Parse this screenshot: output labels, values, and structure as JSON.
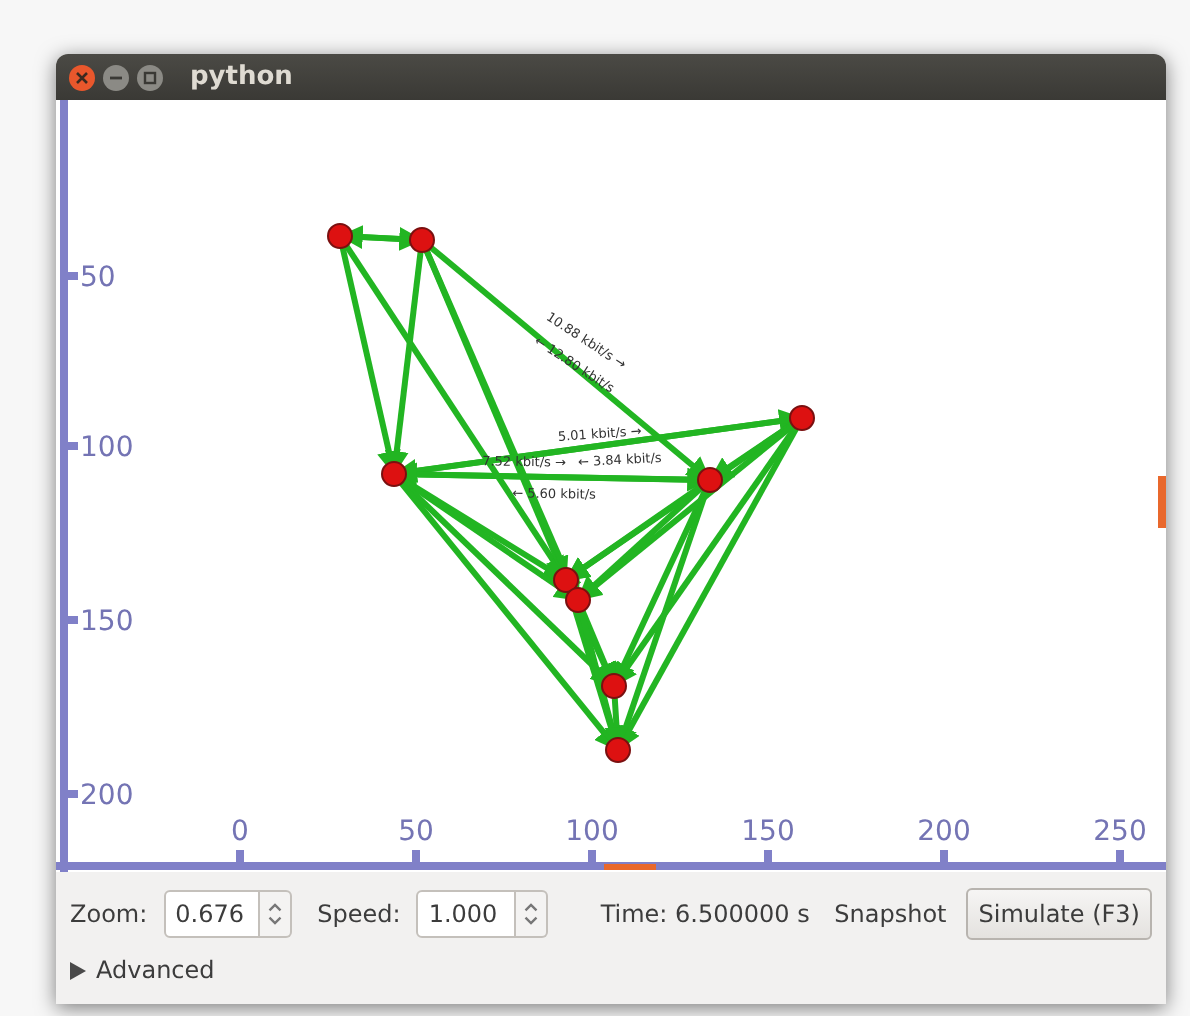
{
  "window": {
    "title": "python"
  },
  "plot": {
    "y_ticks": [
      "50",
      "100",
      "150",
      "200"
    ],
    "x_ticks": [
      "0",
      "50",
      "100",
      "150",
      "200",
      "250"
    ],
    "edge_labels": [
      "10.88 kbit/s →",
      "← 12.80 kbit/s",
      "5.01 kbit/s →",
      "← 3.84 kbit/s",
      "7.52 kbit/s →",
      "← 5.60 kbit/s"
    ]
  },
  "controls": {
    "zoom": {
      "label": "Zoom:",
      "value": "0.676"
    },
    "speed": {
      "label": "Speed:",
      "value": "1.000"
    },
    "time": "Time: 6.500000 s",
    "snapshot": "Snapshot",
    "simulate": "Simulate (F3)"
  },
  "advanced": {
    "label": "Advanced",
    "expanded": false
  }
}
